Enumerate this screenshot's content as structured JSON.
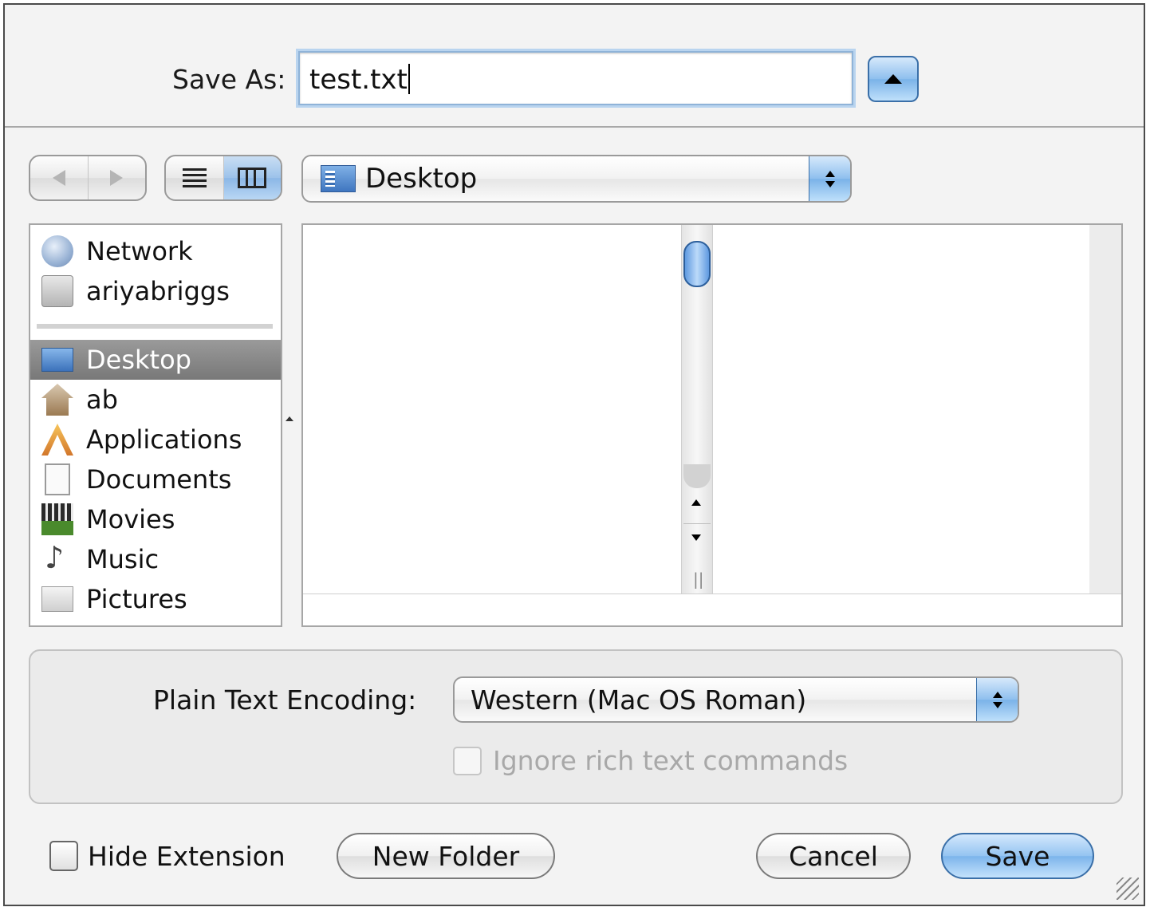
{
  "save_as": {
    "label": "Save As:",
    "filename": "test.txt"
  },
  "location": {
    "current": "Desktop"
  },
  "sidebar": {
    "devices": [
      {
        "label": "Network",
        "icon": "network-icon"
      },
      {
        "label": "ariyabriggs",
        "icon": "hard-drive-icon"
      }
    ],
    "places": [
      {
        "label": "Desktop",
        "icon": "desktop-folder-icon",
        "selected": true
      },
      {
        "label": "ab",
        "icon": "home-icon"
      },
      {
        "label": "Applications",
        "icon": "applications-icon"
      },
      {
        "label": "Documents",
        "icon": "documents-icon"
      },
      {
        "label": "Movies",
        "icon": "movies-icon"
      },
      {
        "label": "Music",
        "icon": "music-icon"
      },
      {
        "label": "Pictures",
        "icon": "pictures-icon"
      }
    ]
  },
  "options": {
    "encoding_label": "Plain Text Encoding:",
    "encoding_value": "Western (Mac OS Roman)",
    "ignore_rich_label": "Ignore rich text commands"
  },
  "footer": {
    "hide_extension_label": "Hide Extension",
    "new_folder_label": "New Folder",
    "cancel_label": "Cancel",
    "save_label": "Save"
  },
  "colors": {
    "accent": "#7ab2e8",
    "selection": "#808080"
  }
}
